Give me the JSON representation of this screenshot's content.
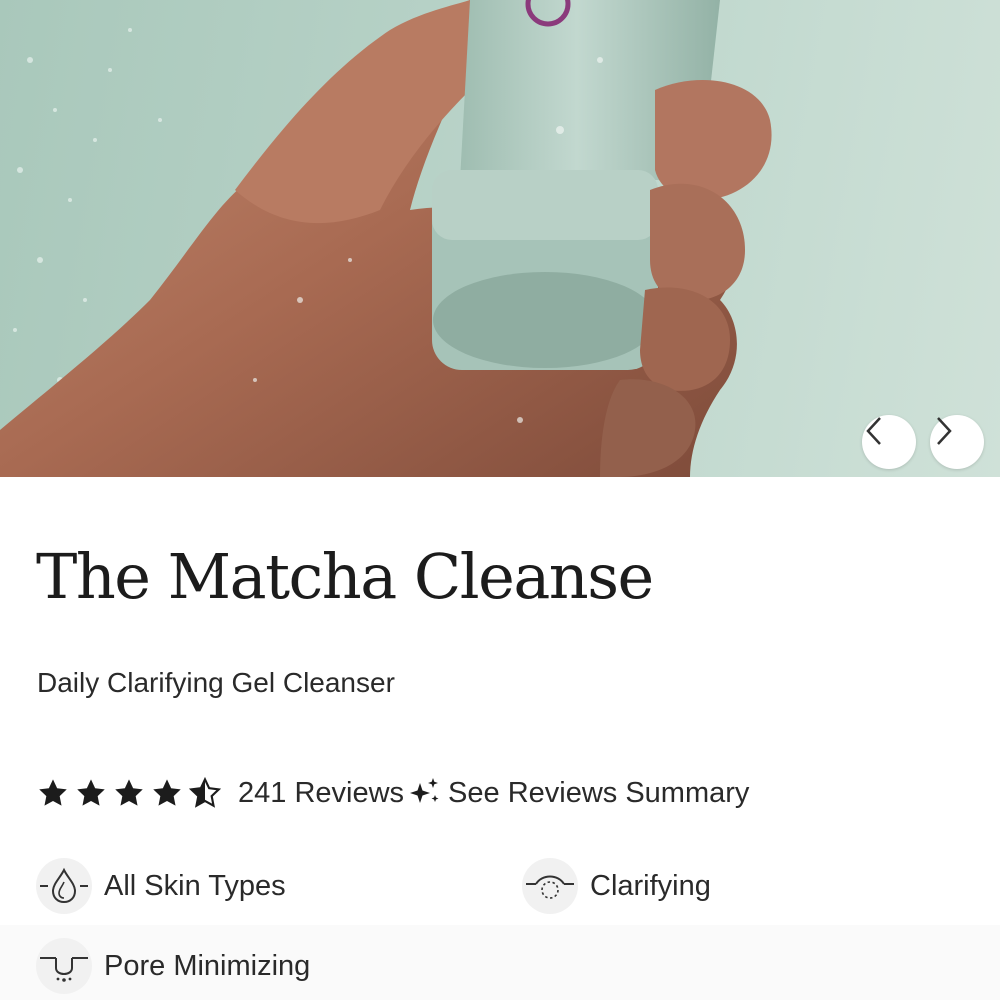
{
  "hero": {
    "image_alt": "hand-holding-matcha-cleanser-tube",
    "prev_icon": "chevron-left-icon",
    "next_icon": "chevron-right-icon"
  },
  "product": {
    "title": "The Matcha Cleanse",
    "subtitle": "Daily Clarifying Gel Cleanser",
    "rating": 4.5,
    "rating_max": 5,
    "review_count": "241 Reviews",
    "summary_link": "See Reviews Summary",
    "summary_icon": "sparkle-icon"
  },
  "attributes": [
    {
      "label": "All Skin Types",
      "icon": "droplet-icon"
    },
    {
      "label": "Clarifying",
      "icon": "clarify-icon"
    },
    {
      "label": "Pore Minimizing",
      "icon": "pore-icon"
    }
  ],
  "colors": {
    "hero_bg": "#b6d1c6",
    "tube": "#b3ccc1",
    "text": "#1c1c1c",
    "star": "#1c1c1c"
  }
}
